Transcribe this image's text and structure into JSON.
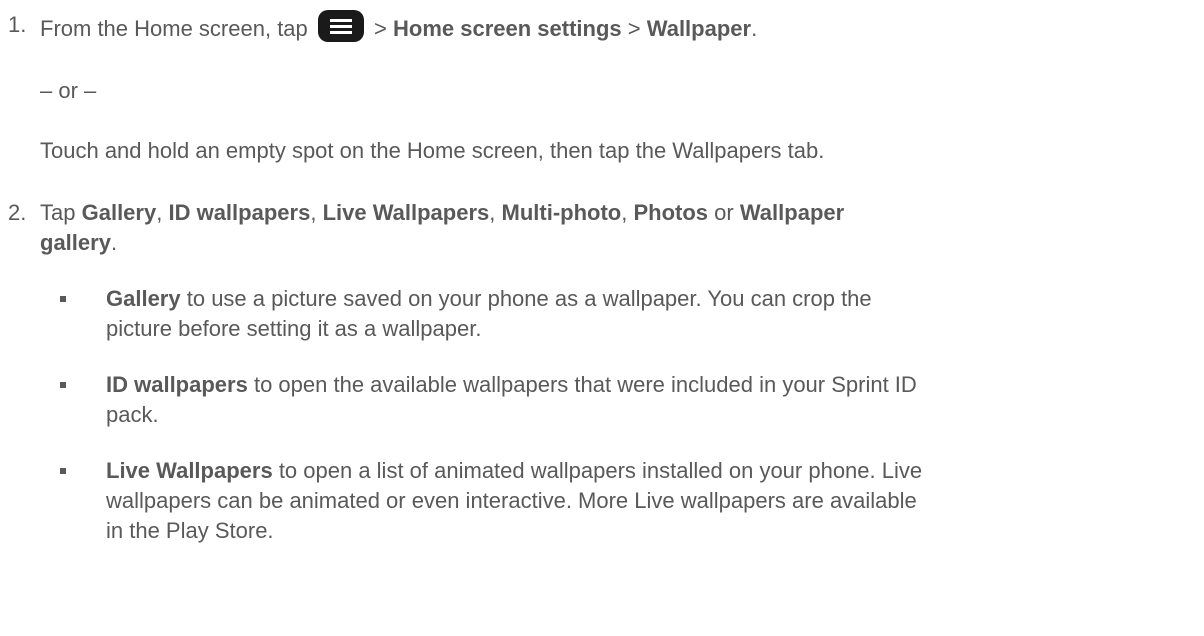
{
  "step1": {
    "number": "1.",
    "prefix": "From the Home screen, tap",
    "sep1": ">",
    "bold1": "Home screen settings",
    "sep2": ">",
    "bold2": "Wallpaper",
    "end": ".",
    "menu_icon": "menu-icon",
    "or_text": "– or –",
    "alt_text": "Touch and hold an empty spot on the Home screen, then tap the Wallpapers tab."
  },
  "step2": {
    "number": "2.",
    "tap": "Tap",
    "opt1": "Gallery",
    "opt2": "ID wallpapers",
    "opt3": "Live Wallpapers",
    "opt4": "Multi-photo",
    "opt5": "Photos",
    "or_word": "or",
    "opt6_line1": "Wallpaper",
    "opt6_line2": "gallery",
    "end": ".",
    "comma": ","
  },
  "bullets": [
    {
      "bold": "Gallery",
      "line1": "to use a picture saved on your phone as a wallpaper. You can crop the",
      "line2": "picture before setting it as a wallpaper."
    },
    {
      "bold": "ID wallpapers",
      "line1": "to open the available wallpapers that were included in your Sprint ID",
      "line2": "pack."
    },
    {
      "bold": "Live Wallpapers",
      "line1": "to open a list of animated wallpapers installed on your phone. Live",
      "line2": "wallpapers can be animated or even interactive. More Live wallpapers are available",
      "line3": "in the Play Store."
    }
  ]
}
